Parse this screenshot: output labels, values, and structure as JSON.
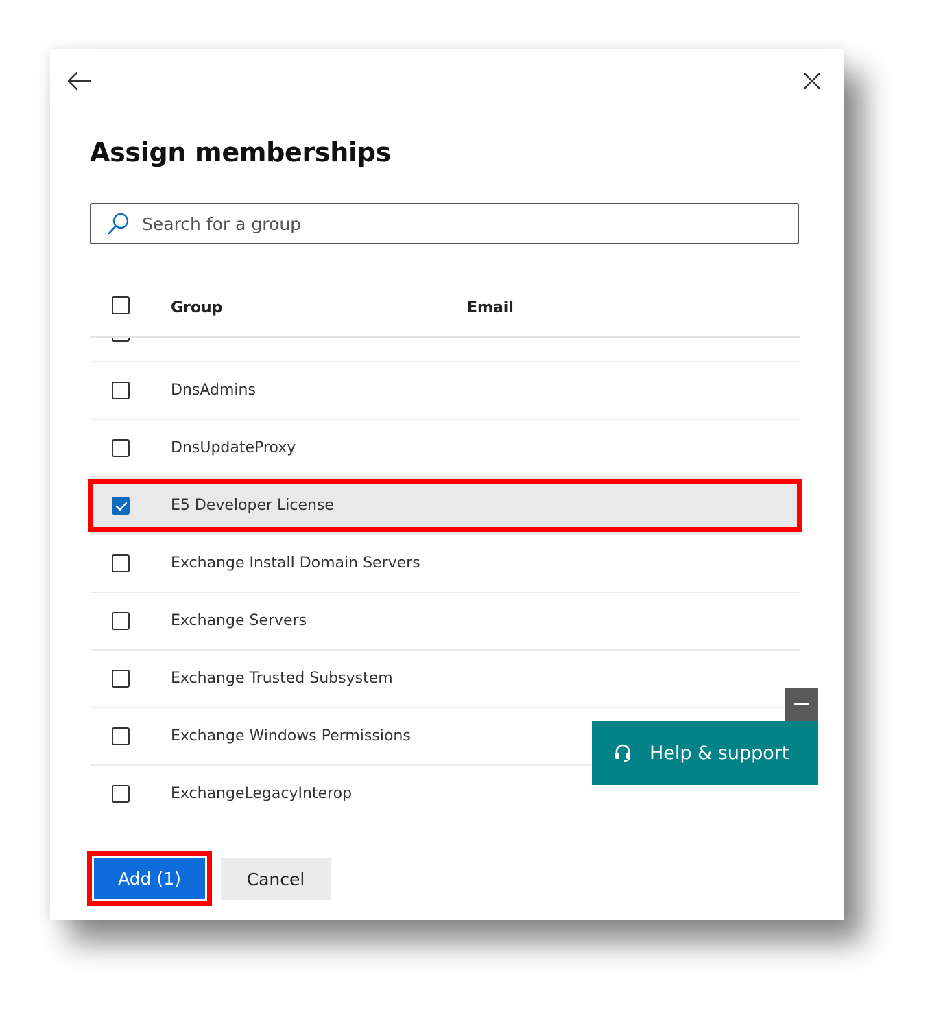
{
  "dialog": {
    "title": "Assign memberships"
  },
  "search": {
    "placeholder": "Search for a group",
    "value": ""
  },
  "table": {
    "columns": {
      "group": "Group",
      "email": "Email"
    },
    "rows": [
      {
        "name": "DnsAdmins",
        "checked": false
      },
      {
        "name": "DnsUpdateProxy",
        "checked": false
      },
      {
        "name": "E5 Developer License",
        "checked": true
      },
      {
        "name": "Exchange Install Domain Servers",
        "checked": false
      },
      {
        "name": "Exchange Servers",
        "checked": false
      },
      {
        "name": "Exchange Trusted Subsystem",
        "checked": false
      },
      {
        "name": "Exchange Windows Permissions",
        "checked": false
      },
      {
        "name": "ExchangeLegacyInterop",
        "checked": false
      }
    ]
  },
  "help": {
    "label": "Help & support"
  },
  "footer": {
    "add_label": "Add (1)",
    "cancel_label": "Cancel"
  },
  "colors": {
    "primary": "#0f6cdb",
    "checked": "#0f6cbd",
    "help_bg": "#038387",
    "highlight": "#ff0000",
    "selected_row": "#e9e9e9"
  }
}
